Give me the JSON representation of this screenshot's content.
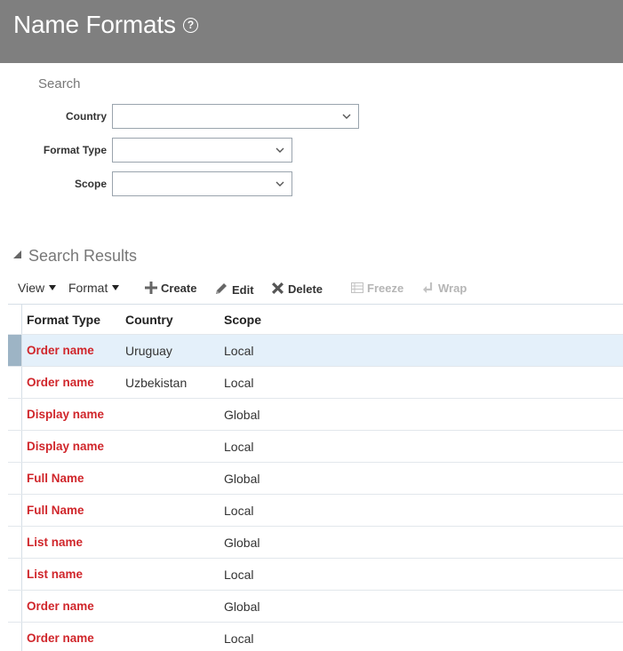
{
  "page": {
    "title": "Name Formats"
  },
  "search": {
    "heading": "Search",
    "fields": [
      {
        "label": "Country",
        "value": ""
      },
      {
        "label": "Format Type",
        "value": ""
      },
      {
        "label": "Scope",
        "value": ""
      }
    ]
  },
  "results": {
    "heading": "Search Results",
    "toolbar": {
      "view": "View",
      "format": "Format",
      "create": "Create",
      "edit": "Edit",
      "delete": "Delete",
      "freeze": "Freeze",
      "wrap": "Wrap"
    },
    "columns": [
      "Format Type",
      "Country",
      "Scope"
    ],
    "rows": [
      {
        "format_type": "Order name",
        "country": "Uruguay",
        "scope": "Local"
      },
      {
        "format_type": "Order name",
        "country": "Uzbekistan",
        "scope": "Local"
      },
      {
        "format_type": "Display name",
        "country": "",
        "scope": "Global"
      },
      {
        "format_type": "Display name",
        "country": "",
        "scope": "Local"
      },
      {
        "format_type": "Full Name",
        "country": "",
        "scope": "Global"
      },
      {
        "format_type": "Full Name",
        "country": "",
        "scope": "Local"
      },
      {
        "format_type": "List name",
        "country": "",
        "scope": "Global"
      },
      {
        "format_type": "List name",
        "country": "",
        "scope": "Local"
      },
      {
        "format_type": "Order name",
        "country": "",
        "scope": "Global"
      },
      {
        "format_type": "Order name",
        "country": "",
        "scope": "Local"
      }
    ]
  },
  "colors": {
    "header_bg": "#7f7f7f",
    "link": "#d0262b",
    "selected_row": "#e4f0fa"
  }
}
